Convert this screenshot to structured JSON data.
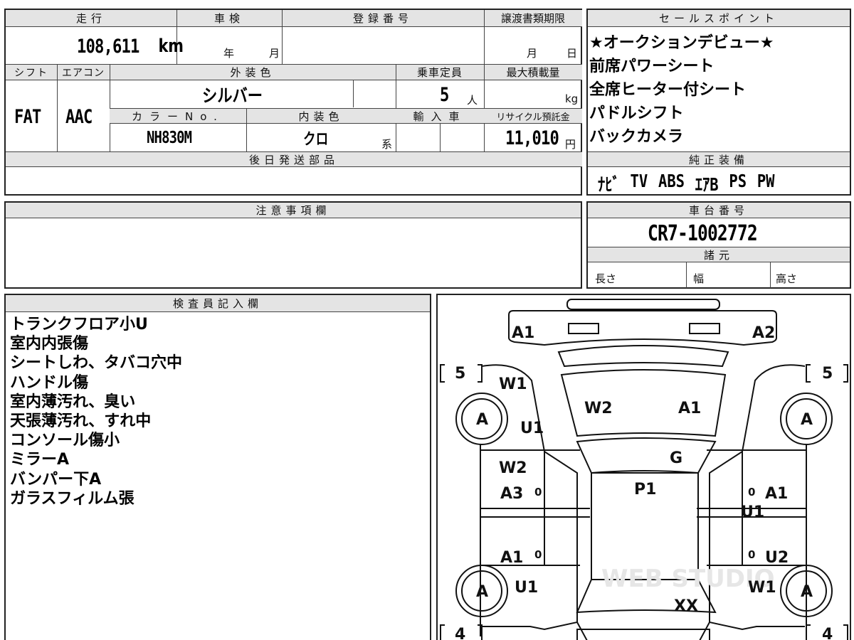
{
  "top_info": {
    "mileage_label": "走行",
    "mileage_value": "108,611",
    "mileage_unit": "km",
    "shaken_label": "車検",
    "shaken_year": "年",
    "shaken_month": "月",
    "reg_no_label": "登録番号",
    "transfer_label": "譲渡書類期限",
    "transfer_month": "月",
    "transfer_day": "日",
    "shift_label": "シフト",
    "shift_value": "FAT",
    "ac_label": "エアコン",
    "ac_value": "AAC",
    "exterior_label": "外装色",
    "exterior_value": "シルバー",
    "capacity_label": "乗車定員",
    "capacity_value": "5",
    "capacity_unit": "人",
    "load_label": "最大積載量",
    "load_unit": "kg",
    "color_no_label": "カラーNo.",
    "color_no_value": "NH830M",
    "interior_label": "内装色",
    "interior_value": "クロ",
    "interior_suffix": "系",
    "import_label": "輸入車",
    "recycle_label": "リサイクル預託金",
    "recycle_value": "11,010",
    "recycle_unit": "円",
    "later_parts_label": "後日発送部品"
  },
  "sales_points": {
    "label": "セールスポイント",
    "items": [
      "★オークションデビュー★",
      "前席パワーシート",
      "全席ヒーター付シート",
      "パドルシフト",
      "バックカメラ"
    ]
  },
  "equipment": {
    "label": "純正装備",
    "items": [
      "ﾅﾋﾞ",
      "TV",
      "ABS",
      "ｴｱB",
      "PS",
      "PW"
    ]
  },
  "notes": {
    "label": "注意事項欄"
  },
  "chassis": {
    "label": "車台番号",
    "value": "CR7-1002772"
  },
  "specs": {
    "label": "諸元",
    "length": "長さ",
    "width": "幅",
    "height": "高さ"
  },
  "inspector": {
    "label": "検査員記入欄",
    "lines": [
      "トランクフロア小U",
      "室内内張傷",
      "シートしわ、タバコ穴中",
      "ハンドル傷",
      "室内薄汚れ、臭い",
      "天張薄汚れ、すれ中",
      "コンソール傷小",
      "ミラーA",
      "バンパー下A",
      "ガラスフィルム張"
    ]
  },
  "diagram": {
    "marks": {
      "front_left": "A1",
      "front_right": "A2",
      "fender_left": "W1",
      "hood_w": "W2",
      "hood_a": "A1",
      "fender_left_u": "U1",
      "windshield": "G",
      "roof": "P1",
      "door_fl_w": "W2",
      "door_fl_a": "A3",
      "door_fr_a": "A1",
      "door_fr_u": "U1",
      "door_rl_a": "A1",
      "door_rr_u": "U2",
      "rear_left_u": "U1",
      "rear_right_w": "W1",
      "rear": "XX"
    },
    "tire_left_front": "5",
    "tire_right_front": "5",
    "tire_left_rear": "4",
    "tire_right_rear": "4",
    "wheel": "A",
    "zero": "0",
    "watermark": "WEB STUDIO"
  }
}
